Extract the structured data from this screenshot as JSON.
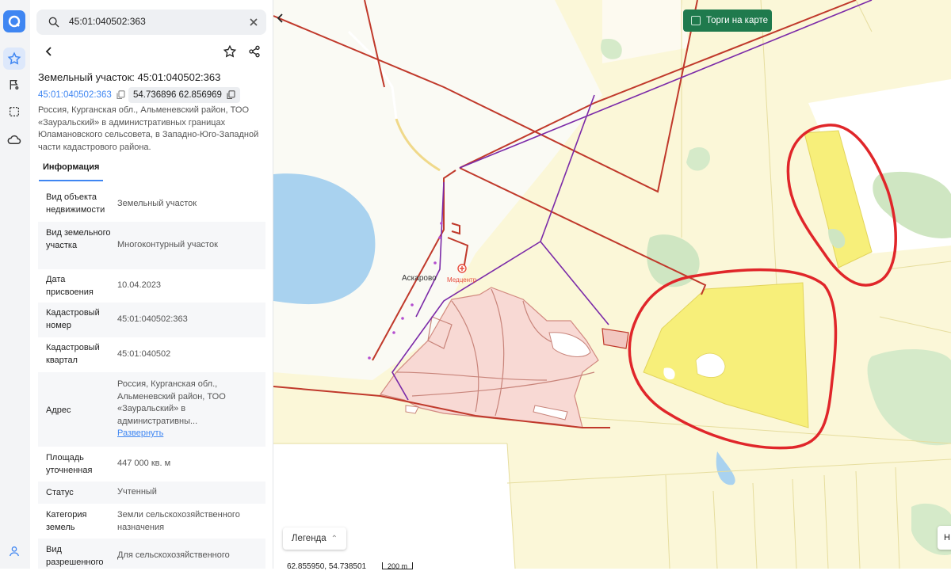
{
  "search": {
    "value": "45:01:040502:363"
  },
  "object": {
    "title": "Земельный участок: 45:01:040502:363",
    "cadastral_link": "45:01:040502:363",
    "coordinates": "54.736896 62.856969",
    "address_full": "Россия, Курганская обл., Альменевский район, ТОО «Зауральский» в административных границах Юламановского сельсовета, в Западно-Юго-Западной части кадастрового района."
  },
  "tabs": {
    "info": "Информация"
  },
  "info_rows": [
    {
      "label": "Вид объекта недвижимости",
      "value": "Земельный участок"
    },
    {
      "label": "Вид земельного участка",
      "value": "Многоконтурный участок"
    },
    {
      "label": "Дата присвоения",
      "value": "10.04.2023"
    },
    {
      "label": "Кадастровый номер",
      "value": "45:01:040502:363"
    },
    {
      "label": "Кадастровый квартал",
      "value": "45:01:040502"
    },
    {
      "label": "Адрес",
      "value": "Россия, Курганская обл., Альменевский район, ТОО «Зауральский» в административны...",
      "link": "Развернуть"
    },
    {
      "label": "Площадь уточненная",
      "value": "447 000 кв. м"
    },
    {
      "label": "Статус",
      "value": "Учтенный"
    },
    {
      "label": "Категория земель",
      "value": "Земли сельскохозяйственного назначения"
    },
    {
      "label": "Вид разрешенного",
      "value": "Для сельскохозяйственного"
    }
  ],
  "map": {
    "torgi_label": "Торги на карте",
    "legend_label": "Легенда",
    "coords_readout": "62.855950, 54.738501",
    "scale_label": "200 m",
    "right_button_label": "Н",
    "town_label": "Аскарово",
    "poi_label": "Медцентр"
  },
  "colors": {
    "accent": "#3f86f2",
    "torgi_green": "#1f7a4d",
    "parcel_red": "#c0392b",
    "highlight_yellow": "#f7ef7a",
    "annotation_red": "#e0262a"
  },
  "icons": {
    "logo": "app-logo-icon",
    "favorites": "star-icon",
    "flag": "flag-icon",
    "select": "select-area-icon",
    "cloud": "cloud-icon",
    "user": "user-icon"
  }
}
